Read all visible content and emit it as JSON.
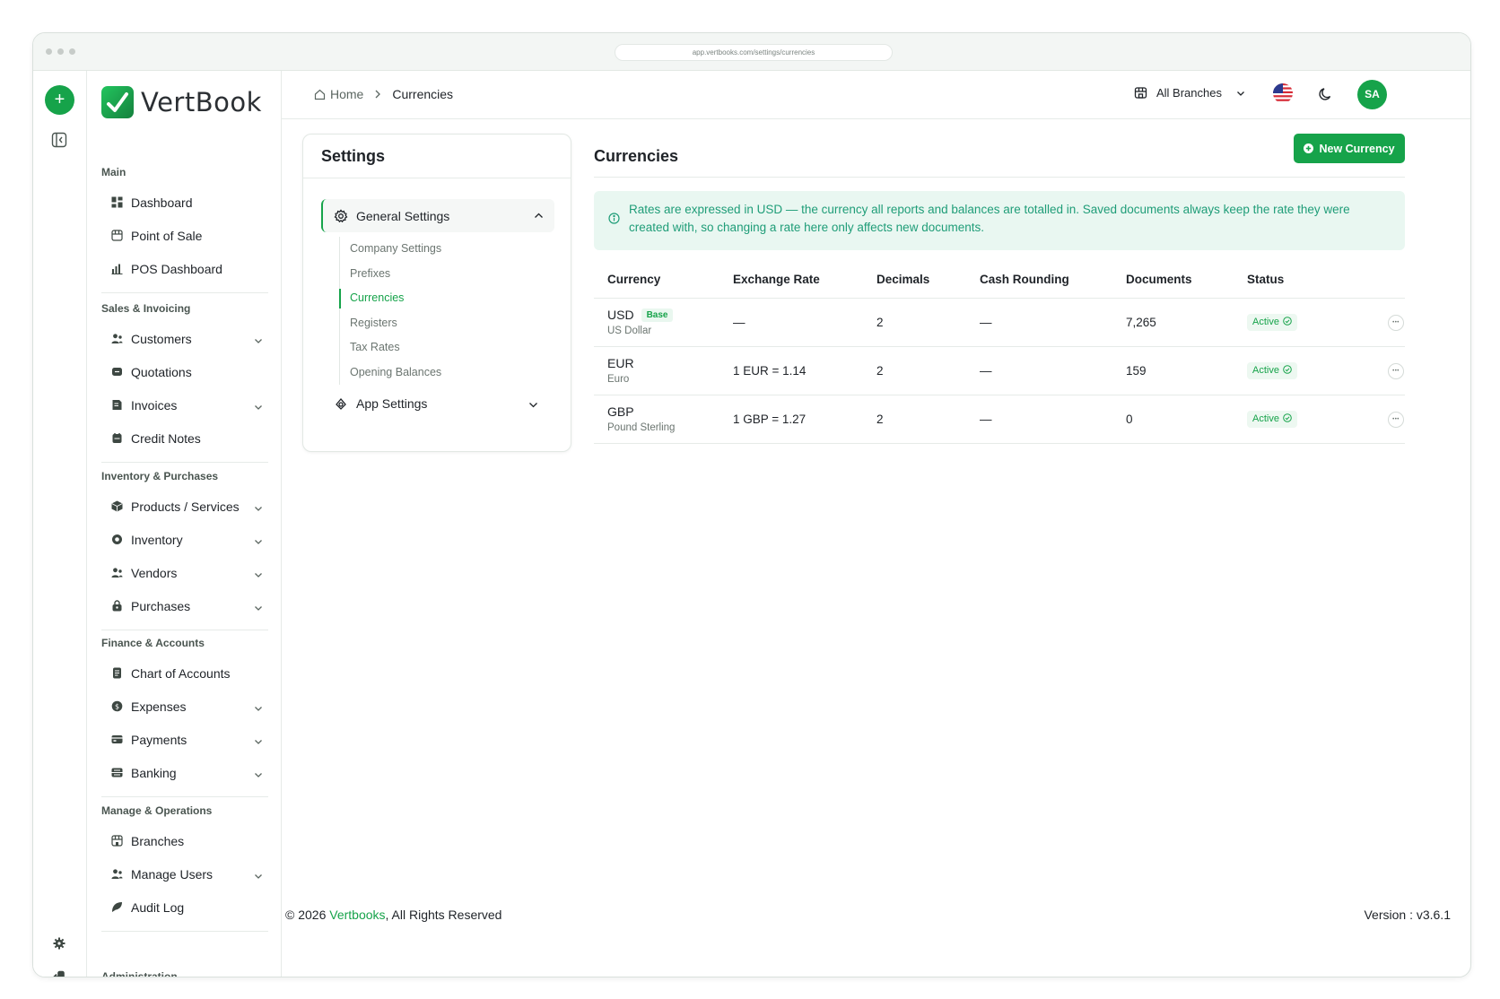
{
  "browser": {
    "url": "app.vertbooks.com/settings/currencies"
  },
  "brand": {
    "name": "VertBook"
  },
  "sidebar": {
    "groups": [
      {
        "title": "Main",
        "items": [
          {
            "label": "Dashboard",
            "icon": "dashboard-icon",
            "chevron": false
          },
          {
            "label": "Point of Sale",
            "icon": "pos-icon",
            "chevron": false
          },
          {
            "label": "POS Dashboard",
            "icon": "chart-icon",
            "chevron": false
          }
        ]
      },
      {
        "title": "Sales & Invoicing",
        "items": [
          {
            "label": "Customers",
            "icon": "users-icon",
            "chevron": true
          },
          {
            "label": "Quotations",
            "icon": "quote-icon",
            "chevron": false
          },
          {
            "label": "Invoices",
            "icon": "invoice-icon",
            "chevron": true
          },
          {
            "label": "Credit Notes",
            "icon": "note-icon",
            "chevron": false
          }
        ]
      },
      {
        "title": "Inventory & Purchases",
        "items": [
          {
            "label": "Products / Services",
            "icon": "box-icon",
            "chevron": true
          },
          {
            "label": "Inventory",
            "icon": "inventory-icon",
            "chevron": true
          },
          {
            "label": "Vendors",
            "icon": "vendor-icon",
            "chevron": true
          },
          {
            "label": "Purchases",
            "icon": "bag-icon",
            "chevron": true
          }
        ]
      },
      {
        "title": "Finance & Accounts",
        "items": [
          {
            "label": "Chart of Accounts",
            "icon": "ledger-icon",
            "chevron": false
          },
          {
            "label": "Expenses",
            "icon": "coin-icon",
            "chevron": true
          },
          {
            "label": "Payments",
            "icon": "card-icon",
            "chevron": true
          },
          {
            "label": "Banking",
            "icon": "bank-icon",
            "chevron": true
          }
        ]
      },
      {
        "title": "Manage & Operations",
        "items": [
          {
            "label": "Branches",
            "icon": "store-icon",
            "chevron": false
          },
          {
            "label": "Manage Users",
            "icon": "users-icon",
            "chevron": true
          },
          {
            "label": "Audit Log",
            "icon": "log-icon",
            "chevron": false
          }
        ]
      }
    ],
    "cut_off_group_title": "Administration"
  },
  "header": {
    "breadcrumb": {
      "home": "Home",
      "current": "Currencies"
    },
    "branch_selector": "All Branches",
    "avatar_initials": "SA"
  },
  "settings": {
    "title": "Settings",
    "general_label": "General Settings",
    "sub_items": [
      "Company Settings",
      "Prefixes",
      "Currencies",
      "Registers",
      "Tax Rates",
      "Opening Balances"
    ],
    "active_index": 2,
    "app_label": "App Settings"
  },
  "main": {
    "title": "Currencies",
    "new_button": "New Currency",
    "notice": "Rates are expressed in USD — the currency all reports and balances are totalled in. Saved documents always keep the rate they were created with, so changing a rate here only affects new documents.",
    "columns": [
      "Currency",
      "Exchange Rate",
      "Decimals",
      "Cash Rounding",
      "Documents",
      "Status"
    ],
    "rows": [
      {
        "code": "USD",
        "name": "US Dollar",
        "badge": "Base",
        "rate": "—",
        "decimals": "2",
        "rounding": "—",
        "documents": "7,265",
        "status": "Active"
      },
      {
        "code": "EUR",
        "name": "Euro",
        "badge": "",
        "rate": "1 EUR = 1.14",
        "decimals": "2",
        "rounding": "—",
        "documents": "159",
        "status": "Active"
      },
      {
        "code": "GBP",
        "name": "Pound Sterling",
        "badge": "",
        "rate": "1 GBP = 1.27",
        "decimals": "2",
        "rounding": "—",
        "documents": "0",
        "status": "Active"
      }
    ]
  },
  "footer": {
    "prefix": "© 2026 ",
    "brand": "Vertbooks",
    "suffix": ", All Rights Reserved",
    "version": "Version : v3.6.1"
  },
  "colors": {
    "accent": "#16a34a",
    "notice_bg": "#e9f7f1",
    "notice_text": "#1f9d78"
  }
}
